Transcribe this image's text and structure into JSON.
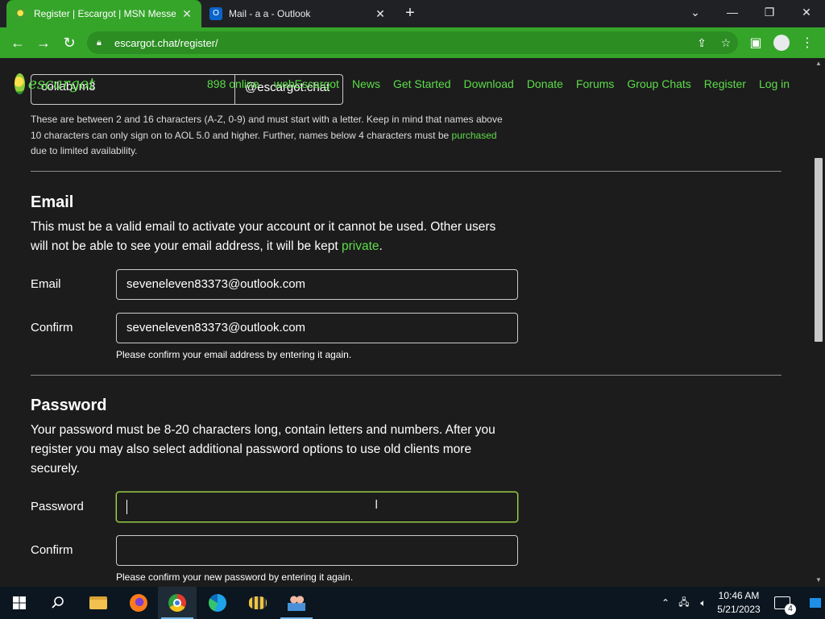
{
  "browser": {
    "tabs": [
      {
        "title": "Register | Escargot | MSN Messe",
        "active": true,
        "favicon": "escargot-icon"
      },
      {
        "title": "Mail - a a - Outlook",
        "active": false,
        "favicon": "outlook-icon"
      }
    ],
    "url": "escargot.chat/register/",
    "accent": "#35a52a"
  },
  "site": {
    "logo_text": "escargot",
    "online": "898 online",
    "nav": [
      "webEscargot",
      "News",
      "Get Started",
      "Download",
      "Donate",
      "Forums",
      "Group Chats",
      "Register",
      "Log in"
    ]
  },
  "username": {
    "value": "collabvm3",
    "suffix": "@escargot.chat",
    "hint_pre": "These are between 2 and 16 characters (A-Z, 0-9) and must start with a letter. Keep in mind that names above 10 characters can only sign on to AOL 5.0 and higher. Further, names below 4 characters must be",
    "hint_link": "purchased",
    "hint_post": "due to limited availability."
  },
  "email": {
    "heading": "Email",
    "desc_pre": "This must be a valid email to activate your account or it cannot be used. Other users will not be able to see your email address, it will be kept",
    "desc_link": "private",
    "desc_post": ".",
    "label": "Email",
    "value": "seveneleven83373@outlook.com",
    "confirm_label": "Confirm",
    "confirm_value": "seveneleven83373@outlook.com",
    "confirm_hint": "Please confirm your email address by entering it again."
  },
  "password": {
    "heading": "Password",
    "desc": "Your password must be 8-20 characters long, contain letters and numbers. After you register you may also select additional password options to use old clients more securely.",
    "label": "Password",
    "value": "",
    "confirm_label": "Confirm",
    "confirm_value": "",
    "confirm_hint": "Please confirm your new password by entering it again."
  },
  "taskbar": {
    "time": "10:46 AM",
    "date": "5/21/2023",
    "notification_count": "4"
  }
}
